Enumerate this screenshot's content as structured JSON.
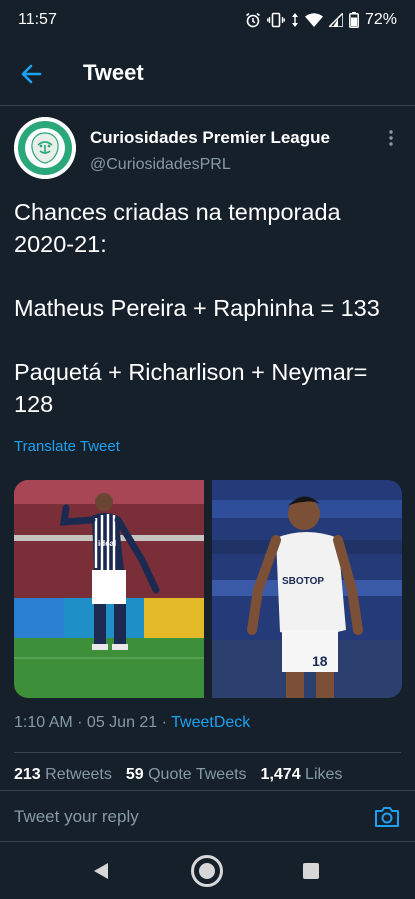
{
  "status_bar": {
    "time": "11:57",
    "battery": "72%",
    "icons": [
      "alarm-icon",
      "vibrate-icon",
      "data-arrows-icon",
      "wifi-icon",
      "signal-icon",
      "battery-icon"
    ]
  },
  "header": {
    "title": "Tweet",
    "back_icon": "arrow-left-icon"
  },
  "author": {
    "name": "Curiosidades Premier League",
    "handle": "@CuriosidadesPRL",
    "avatar_text": "CURIOSIDADES",
    "avatar_sub": "PL"
  },
  "tweet": {
    "text": "Chances criadas na temporada 2020-21:\n\nMatheus Pereira + Raphinha = 133\n\nPaquetá + Richarlison + Neymar= 128",
    "translate_label": "Translate Tweet",
    "media": [
      {
        "kind": "photo",
        "jersey_text": "ideal"
      },
      {
        "kind": "photo",
        "jersey_text": "SBOTOP",
        "number": "18"
      }
    ],
    "time": "1:10 AM",
    "date": "05 Jun 21",
    "source": "TweetDeck"
  },
  "stats": {
    "retweets_count": "213",
    "retweets_label": "Retweets",
    "quotes_count": "59",
    "quotes_label": "Quote Tweets",
    "likes_count": "1,474",
    "likes_label": "Likes"
  },
  "reply": {
    "placeholder": "Tweet your reply"
  },
  "colors": {
    "background": "#15202b",
    "accent": "#1da1f2",
    "muted": "#8899a6",
    "divider": "#38444d"
  }
}
